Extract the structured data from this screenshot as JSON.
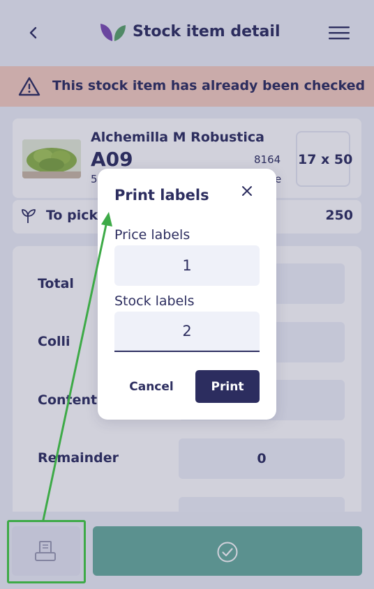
{
  "header": {
    "title": "Stock item detail",
    "back_icon": "chevron-left-icon",
    "logo_icon": "leaf-logo-icon",
    "menu_icon": "hamburger-menu-icon"
  },
  "banner": {
    "text": "This stock item has already been checked",
    "icon": "warning-icon",
    "color": "#f6cfc1"
  },
  "item": {
    "name": "Alchemilla M Robustica",
    "code": "A09",
    "number": "8164",
    "sub_left": "5",
    "sub_right": "e",
    "size": "17 x 50"
  },
  "to_pick": {
    "label": "To pick:",
    "value": "250",
    "icon": "plant-icon"
  },
  "form": {
    "rows": [
      {
        "label": "Total",
        "value": ""
      },
      {
        "label": "Colli",
        "value": ""
      },
      {
        "label": "Content",
        "value": ""
      },
      {
        "label": "Remainder",
        "value": "0"
      }
    ]
  },
  "footer": {
    "print_icon": "printer-icon",
    "confirm_icon": "check-circle-icon",
    "confirm_color": "#68ad9e"
  },
  "modal": {
    "title": "Print labels",
    "close_icon": "close-icon",
    "price_label": "Price labels",
    "price_value": "1",
    "stock_label": "Stock labels",
    "stock_value": "2",
    "cancel_label": "Cancel",
    "print_label": "Print"
  },
  "colors": {
    "primary": "#2c2d5f",
    "accent_annotation": "#3daa47"
  }
}
